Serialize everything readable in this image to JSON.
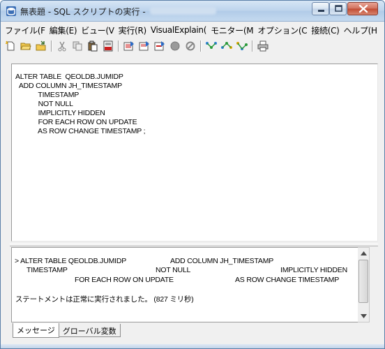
{
  "window": {
    "title": "無表題 - SQL スクリプトの実行 -",
    "controls": [
      "minimize-icon",
      "maximize-icon",
      "close-icon"
    ]
  },
  "menu": [
    "ファイル(F",
    "編集(E)",
    "ビュー(V",
    "実行(R)",
    "VisualExplain(",
    "モニター(M",
    "オプション(C",
    "接続(C)",
    "ヘルプ(H"
  ],
  "toolbar": {
    "icons": [
      "new-icon",
      "open-icon",
      "save-icon",
      "cut-icon",
      "copy-icon",
      "paste-icon",
      "save-sql-icon",
      "run-icon",
      "run-step-icon",
      "run-current-icon",
      "stop-icon",
      "cancel-icon",
      "explain-icon",
      "explain-all-icon",
      "explain-current-icon",
      "print-icon"
    ]
  },
  "editor": {
    "sql": "ALTER TABLE  QEOLDB.JUMIDP\n  ADD COLUMN JH_TIMESTAMP\n            TIMESTAMP\n            NOT NULL\n            IMPLICITLY HIDDEN\n            FOR EACH ROW ON UPDATE\n            AS ROW CHANGE TIMESTAMP ;"
  },
  "messages": {
    "line1a": "> ALTER TABLE  QEOLDB.JUMIDP",
    "line1b": "ADD COLUMN JH_TIMESTAMP",
    "line2a": "TIMESTAMP",
    "line2b": "NOT NULL",
    "line2c": "IMPLICITLY HIDDEN",
    "line3a": "FOR EACH ROW ON UPDATE",
    "line3b": "AS ROW CHANGE TIMESTAMP",
    "status": "ステートメントは正常に実行されました。 (827 ミリ秒)"
  },
  "tabs": [
    "メッセージ",
    "グローバル変数"
  ],
  "colors": {
    "titlebar": "#c4d9ef",
    "close_button": "#c14a32",
    "window_bg": "#f0f0f0"
  }
}
